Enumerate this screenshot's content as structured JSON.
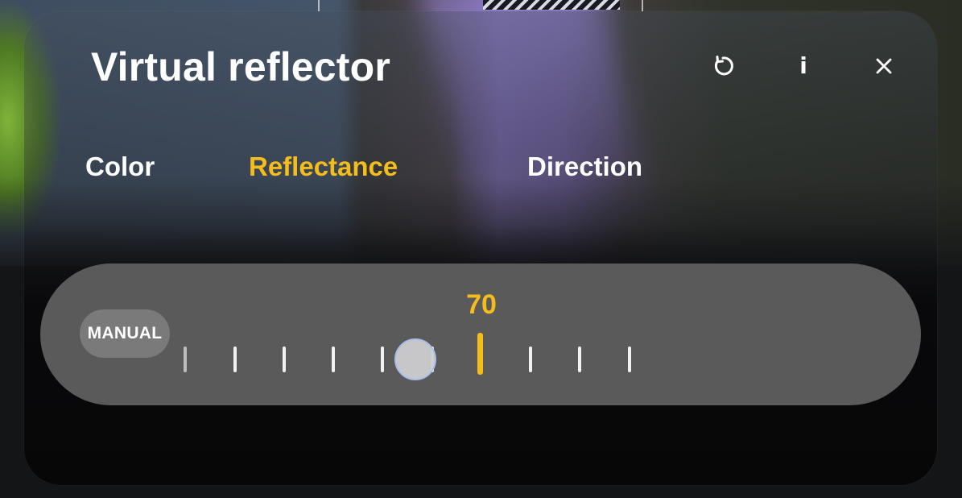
{
  "panel": {
    "title": "Virtual reflector",
    "header_icons": [
      "reset-icon",
      "info-icon",
      "close-icon"
    ]
  },
  "tabs": [
    {
      "label": "Color",
      "active": false
    },
    {
      "label": "Reflectance",
      "active": true
    },
    {
      "label": "Direction",
      "active": false
    }
  ],
  "slider": {
    "mode_label": "MANUAL",
    "value": "70",
    "tick_count": 10,
    "active_tick_index": 6,
    "thumb_tick_index": 5
  },
  "colors": {
    "accent": "#f5bd1a",
    "text": "#ffffff",
    "pill_bg": "#5a5a5b",
    "manual_bg": "#7a7a7b"
  }
}
